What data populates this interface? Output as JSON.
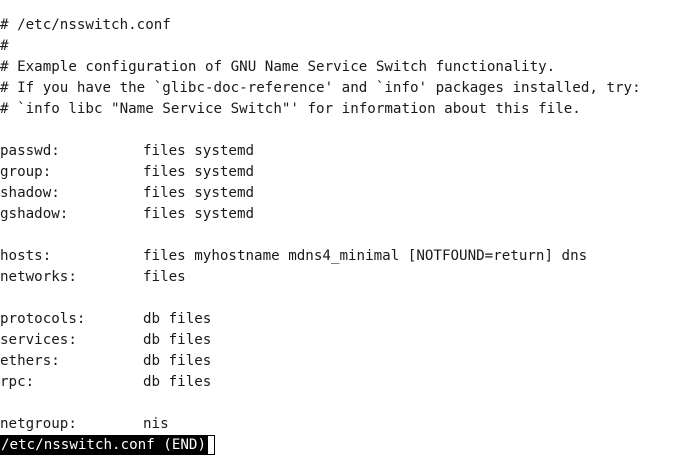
{
  "file": {
    "comments": [
      "# /etc/nsswitch.conf",
      "#",
      "# Example configuration of GNU Name Service Switch functionality.",
      "# If you have the `glibc-doc-reference' and `info' packages installed, try:",
      "# `info libc \"Name Service Switch\"' for information about this file."
    ],
    "groups": [
      [
        {
          "key": "passwd:",
          "value": "files systemd"
        },
        {
          "key": "group:",
          "value": "files systemd"
        },
        {
          "key": "shadow:",
          "value": "files systemd"
        },
        {
          "key": "gshadow:",
          "value": "files systemd"
        }
      ],
      [
        {
          "key": "hosts:",
          "value": "files myhostname mdns4_minimal [NOTFOUND=return] dns"
        },
        {
          "key": "networks:",
          "value": "files"
        }
      ],
      [
        {
          "key": "protocols:",
          "value": "db files"
        },
        {
          "key": "services:",
          "value": "db files"
        },
        {
          "key": "ethers:",
          "value": "db files"
        },
        {
          "key": "rpc:",
          "value": "db files"
        }
      ],
      [
        {
          "key": "netgroup:",
          "value": "nis"
        }
      ]
    ]
  },
  "status_bar": {
    "text": "/etc/nsswitch.conf (END)"
  }
}
